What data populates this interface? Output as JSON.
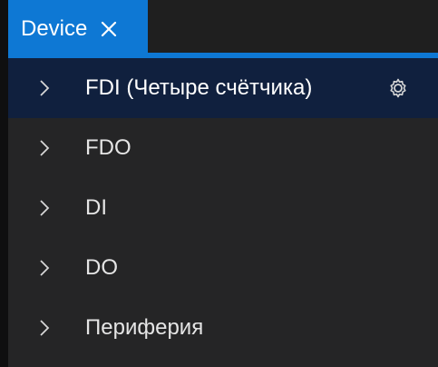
{
  "tabs": [
    {
      "label": "Device",
      "active": true,
      "close_icon": "close-icon"
    }
  ],
  "accent_color": "#0e78d4",
  "selected_row_color": "#10203e",
  "tree": {
    "items": [
      {
        "label": "FDI (Четыре счётчика)",
        "selected": true,
        "icon": "chevron-right-icon",
        "action_icon": "gear-icon"
      },
      {
        "label": "FDO",
        "selected": false,
        "icon": "chevron-right-icon"
      },
      {
        "label": "DI",
        "selected": false,
        "icon": "chevron-right-icon"
      },
      {
        "label": "DO",
        "selected": false,
        "icon": "chevron-right-icon"
      },
      {
        "label": "Периферия",
        "selected": false,
        "icon": "chevron-right-icon"
      }
    ]
  }
}
